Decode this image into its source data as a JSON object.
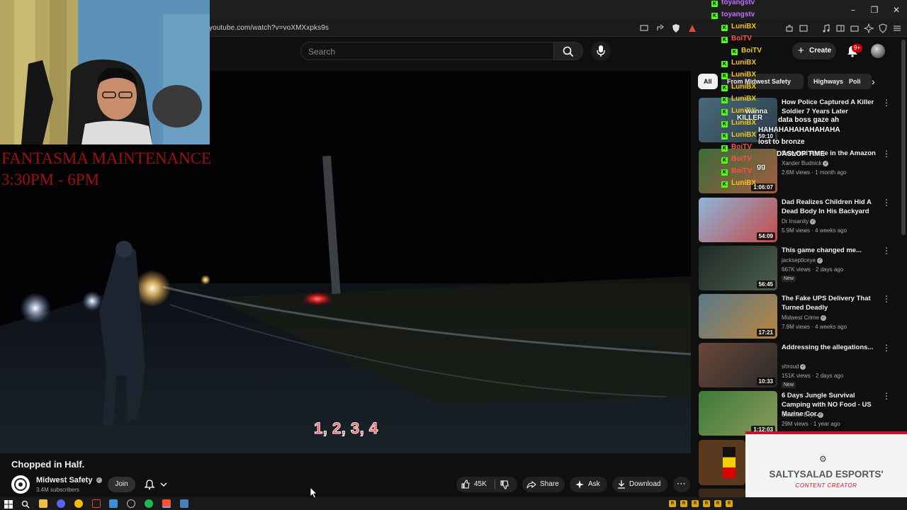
{
  "browser": {
    "url": "youtube.com/watch?v=voXMXxpks9s"
  },
  "header": {
    "search_placeholder": "Search",
    "create_label": "Create",
    "notification_count": "9+"
  },
  "overlay": {
    "maintenance_line1": "FANTASMA MAINTENANCE",
    "maintenance_line2": "3:30PM - 6PM",
    "caption": "1, 2, 3, 4"
  },
  "video": {
    "title": "Chopped in Half.",
    "channel": "Midwest Safety",
    "subscribers": "3.4M subscribers",
    "join_label": "Join",
    "likes": "45K",
    "share_label": "Share",
    "ask_label": "Ask",
    "download_label": "Download"
  },
  "chips": [
    "All",
    "From Midwest Safety",
    "Highways",
    "Poli"
  ],
  "recommendations": [
    {
      "title": "How Police Captured A Killer Soldier 7 Years Later",
      "channel": "",
      "meta": "",
      "duration": "59:10",
      "new": false
    },
    {
      "title": "Survival Alone in the Amazon",
      "channel": "Xander Budnick",
      "meta": "2.6M views · 1 month ago",
      "duration": "1:06:07",
      "new": false
    },
    {
      "title": "Dad Realizes Children Hid A Dead Body In His Backyard",
      "channel": "Dr Insanity",
      "meta": "5.9M views · 4 weeks ago",
      "duration": "54:09",
      "new": false
    },
    {
      "title": "This game changed me...",
      "channel": "jacksepticeye",
      "meta": "667K views · 2 days ago",
      "duration": "56:45",
      "new": true
    },
    {
      "title": "The Fake UPS Delivery That Turned Deadly",
      "channel": "Midwest Crime",
      "meta": "7.9M views · 4 weeks ago",
      "duration": "17:21",
      "new": false
    },
    {
      "title": "Addressing the allegations...",
      "channel": "shroud",
      "meta": "151K views · 2 days ago",
      "duration": "10:33",
      "new": true
    },
    {
      "title": "6 Days Jungle Survival Camping with NO Food - US Marine Cor...",
      "channel": "Outdoor Boys",
      "meta": "29M views · 1 year ago",
      "duration": "1:12:03",
      "new": false
    }
  ],
  "new_label": "New",
  "chat": {
    "names": [
      "toyangstv",
      "toyangstv",
      "LuniBX",
      "BoiTV",
      "BoiTV",
      "LuniBX",
      "LuniBX",
      "LuniBX",
      "LuniBX",
      "LuniBX",
      "LuniBX",
      "LuniBX",
      "BoiTV",
      "BoiTV",
      "BoiTV",
      "LuniBX"
    ],
    "messages": [
      "wanna",
      "KILLER",
      "data boss gaze ah",
      "HAHAHAHAHAHAHAHA",
      "lost to bronze",
      "DASLOP TIME",
      "gg"
    ]
  },
  "esports": {
    "name": "SALTYSALAD ESPORTS'",
    "role": "CONTENT CREATOR"
  }
}
